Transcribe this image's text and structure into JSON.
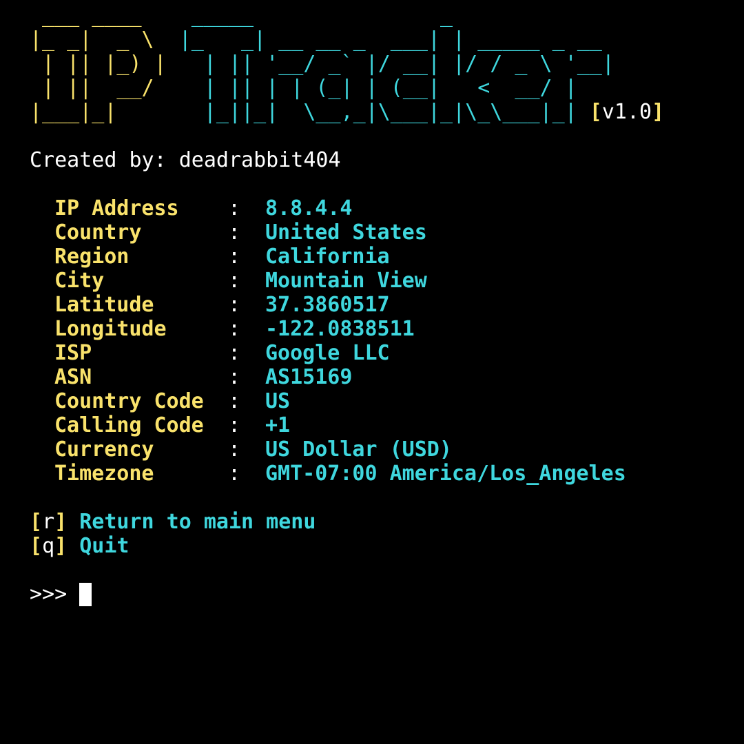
{
  "window": {
    "background": "#000000",
    "colors": {
      "label": "#f9e26b",
      "value": "#3fd7de",
      "text": "#ffffff"
    }
  },
  "banner": {
    "ip_lines": [
      " ___ ____  ",
      "|_ _|  _ \\ ",
      " | || |_) |",
      " | ||  __/ ",
      "|___|_|    "
    ],
    "tracker_lines": [
      "  _____               _             ",
      " |_   _| __ __ _  ___| | _____ _ __ ",
      "   | || '__/ _` |/ __| |/ / _ \\ '__|",
      "   | || | | (_| | (__|   <  __/ |   ",
      "   |_||_|  \\__,_|\\___|_|\\_\\___|_| "
    ],
    "version_open": "[",
    "version": "v1.0",
    "version_close": "]"
  },
  "credits": "Created by: deadrabbit404",
  "separator": ":",
  "info": [
    {
      "label": "IP Address",
      "value": "8.8.4.4"
    },
    {
      "label": "Country",
      "value": "United States"
    },
    {
      "label": "Region",
      "value": "California"
    },
    {
      "label": "City",
      "value": "Mountain View"
    },
    {
      "label": "Latitude",
      "value": "37.3860517"
    },
    {
      "label": "Longitude",
      "value": "-122.0838511"
    },
    {
      "label": "ISP",
      "value": "Google LLC"
    },
    {
      "label": "ASN",
      "value": "AS15169"
    },
    {
      "label": "Country Code",
      "value": "US"
    },
    {
      "label": "Calling Code",
      "value": "+1"
    },
    {
      "label": "Currency",
      "value": "US Dollar (USD)"
    },
    {
      "label": "Timezone",
      "value": "GMT-07:00 America/Los_Angeles"
    }
  ],
  "menu": [
    {
      "key": "r",
      "label": "Return to main menu"
    },
    {
      "key": "q",
      "label": "Quit"
    }
  ],
  "prompt": ">>>"
}
